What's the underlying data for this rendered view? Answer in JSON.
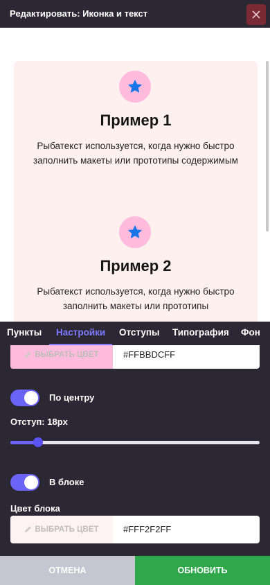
{
  "header": {
    "title": "Редактировать: Иконка и текст",
    "close_icon": "close-icon"
  },
  "preview": {
    "cards": [
      {
        "icon": "star-icon",
        "title": "Пример 1",
        "text": "Рыбатекст используется, когда нужно быстро заполнить макеты или прототипы содержимым"
      },
      {
        "icon": "star-icon",
        "title": "Пример 2",
        "text": "Рыбатекст используется, когда нужно быстро заполнить макеты или прототипы"
      }
    ]
  },
  "tabs": [
    {
      "label": "Пункты",
      "active": false
    },
    {
      "label": "Настройки",
      "active": true
    },
    {
      "label": "Отступы",
      "active": false
    },
    {
      "label": "Типография",
      "active": false
    },
    {
      "label": "Фон",
      "active": false
    }
  ],
  "settings": {
    "icon_bg_color": {
      "button_label": "ВЫБРАТЬ ЦВЕТ",
      "value": "#FFBBDCFF",
      "swatch": "#ffbbdc"
    },
    "center_toggle": {
      "label": "По центру",
      "on": true
    },
    "padding": {
      "label": "Отступ: 18px",
      "value": 18,
      "level": 0.11
    },
    "block_toggle": {
      "label": "В блоке",
      "on": true
    },
    "block_color": {
      "label": "Цвет блока",
      "button_label": "ВЫБРАТЬ ЦВЕТ",
      "value": "#FFF2F2FF",
      "swatch": "#fff2f2"
    }
  },
  "footer": {
    "cancel_label": "ОТМЕНА",
    "update_label": "ОБНОВИТЬ"
  },
  "colors": {
    "accent": "#6b63f5",
    "update": "#2fa84b",
    "cancel": "#c5c6cf",
    "icon": "#1976e8"
  }
}
